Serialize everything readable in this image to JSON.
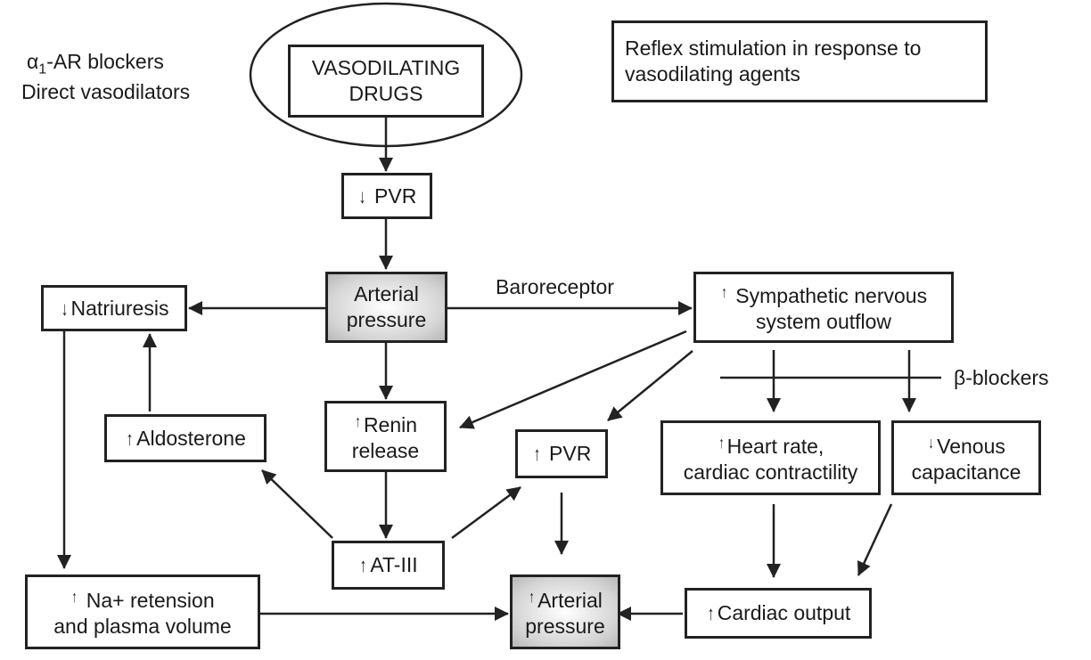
{
  "diagram": {
    "title_note": "Reflex stimulation in response to vasodilating agents",
    "left_note": {
      "alpha_symbol": "α",
      "alpha_sub": "1",
      "alpha_rest": "-AR blockers",
      "line2": "Direct vasodilators"
    },
    "nodes": {
      "vasodilating_drugs": {
        "line1": "VASODILATING",
        "line2": "DRUGS"
      },
      "pvr_down": {
        "arrow": "↓",
        "label": "PVR"
      },
      "arterial_pressure": {
        "line1": "Arterial",
        "line2": "pressure"
      },
      "baroreceptor_label": "Baroreceptor",
      "sympathetic": {
        "arrow": "↑",
        "line1": "Sympathetic nervous",
        "line2": "system outflow"
      },
      "natriuresis": {
        "arrow": "↓",
        "label": "Natriuresis"
      },
      "aldosterone": {
        "arrow": "↑",
        "label": "Aldosterone"
      },
      "renin": {
        "arrow": "↑",
        "line1": "Renin",
        "line2": "release"
      },
      "pvr_up": {
        "arrow": "↑",
        "label": "PVR"
      },
      "beta_blockers_label": "β-blockers",
      "heart_rate": {
        "arrow": "↑",
        "line1": "Heart rate,",
        "line2": "cardiac contractility"
      },
      "venous": {
        "arrow": "↓",
        "line1": "Venous",
        "line2": "capacitance"
      },
      "at3": {
        "arrow": "↑",
        "label": "AT-III"
      },
      "na_retention": {
        "arrow": "↑",
        "line1": "Na+ retension",
        "line2": "and plasma volume"
      },
      "arterial_pressure_up": {
        "arrow": "↑",
        "line1": "Arterial",
        "line2": "pressure"
      },
      "cardiac_output": {
        "arrow": "↑",
        "label": "Cardiac output"
      }
    },
    "edges": [
      {
        "from": "vasodilating_drugs",
        "to": "pvr_down"
      },
      {
        "from": "pvr_down",
        "to": "arterial_pressure"
      },
      {
        "from": "arterial_pressure",
        "to": "natriuresis"
      },
      {
        "from": "arterial_pressure",
        "to": "sympathetic",
        "label": "Baroreceptor"
      },
      {
        "from": "arterial_pressure",
        "to": "renin"
      },
      {
        "from": "sympathetic",
        "to": "renin"
      },
      {
        "from": "sympathetic",
        "to": "pvr_up"
      },
      {
        "from": "sympathetic",
        "to": "heart_rate",
        "blocked_by": "β-blockers"
      },
      {
        "from": "sympathetic",
        "to": "venous",
        "blocked_by": "β-blockers"
      },
      {
        "from": "aldosterone",
        "to": "natriuresis"
      },
      {
        "from": "renin",
        "to": "at3"
      },
      {
        "from": "at3",
        "to": "aldosterone"
      },
      {
        "from": "at3",
        "to": "pvr_up"
      },
      {
        "from": "natriuresis",
        "to": "na_retention"
      },
      {
        "from": "pvr_up",
        "to": "arterial_pressure_up"
      },
      {
        "from": "heart_rate",
        "to": "cardiac_output"
      },
      {
        "from": "venous",
        "to": "cardiac_output"
      },
      {
        "from": "na_retention",
        "to": "arterial_pressure_up"
      },
      {
        "from": "cardiac_output",
        "to": "arterial_pressure_up"
      }
    ]
  }
}
